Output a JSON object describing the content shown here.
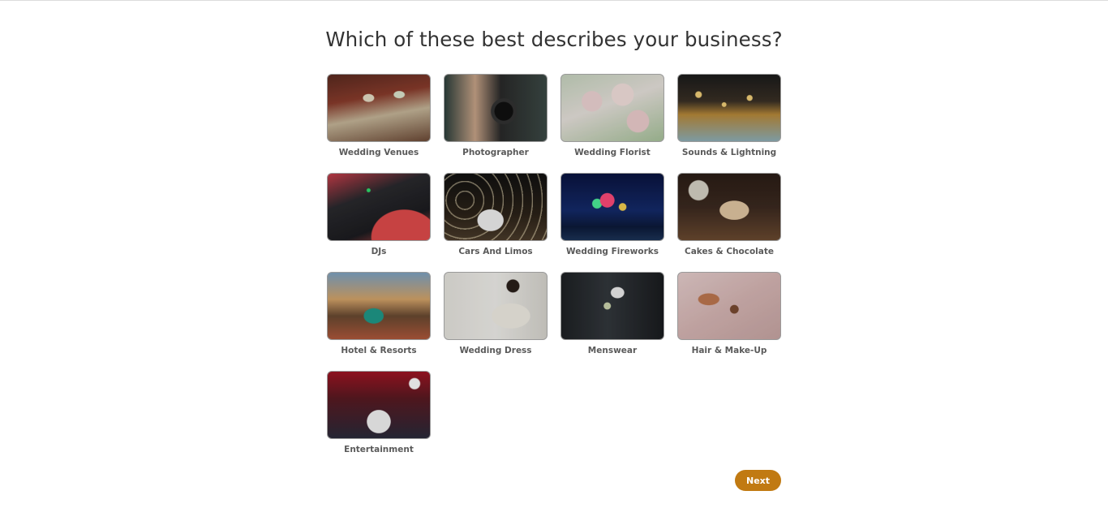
{
  "page": {
    "title": "Which of these best describes your business?"
  },
  "categories": [
    {
      "label": "Wedding Venues",
      "image": "wedding-venues-image"
    },
    {
      "label": "Photographer",
      "image": "photographer-image"
    },
    {
      "label": "Wedding Florist",
      "image": "wedding-florist-image"
    },
    {
      "label": "Sounds & Lightning",
      "image": "sounds-lightning-image"
    },
    {
      "label": "DJs",
      "image": "djs-image"
    },
    {
      "label": "Cars And Limos",
      "image": "cars-limos-image"
    },
    {
      "label": "Wedding Fireworks",
      "image": "wedding-fireworks-image"
    },
    {
      "label": "Cakes & Chocolate",
      "image": "cakes-chocolate-image"
    },
    {
      "label": "Hotel & Resorts",
      "image": "hotel-resorts-image"
    },
    {
      "label": "Wedding Dress",
      "image": "wedding-dress-image"
    },
    {
      "label": "Menswear",
      "image": "menswear-image"
    },
    {
      "label": "Hair & Make-Up",
      "image": "hair-makeup-image"
    },
    {
      "label": "Entertainment",
      "image": "entertainment-image"
    }
  ],
  "actions": {
    "next_label": "Next"
  },
  "colors": {
    "accent": "#c17a12",
    "label_text": "#5a5a5a",
    "title_text": "#333333"
  }
}
